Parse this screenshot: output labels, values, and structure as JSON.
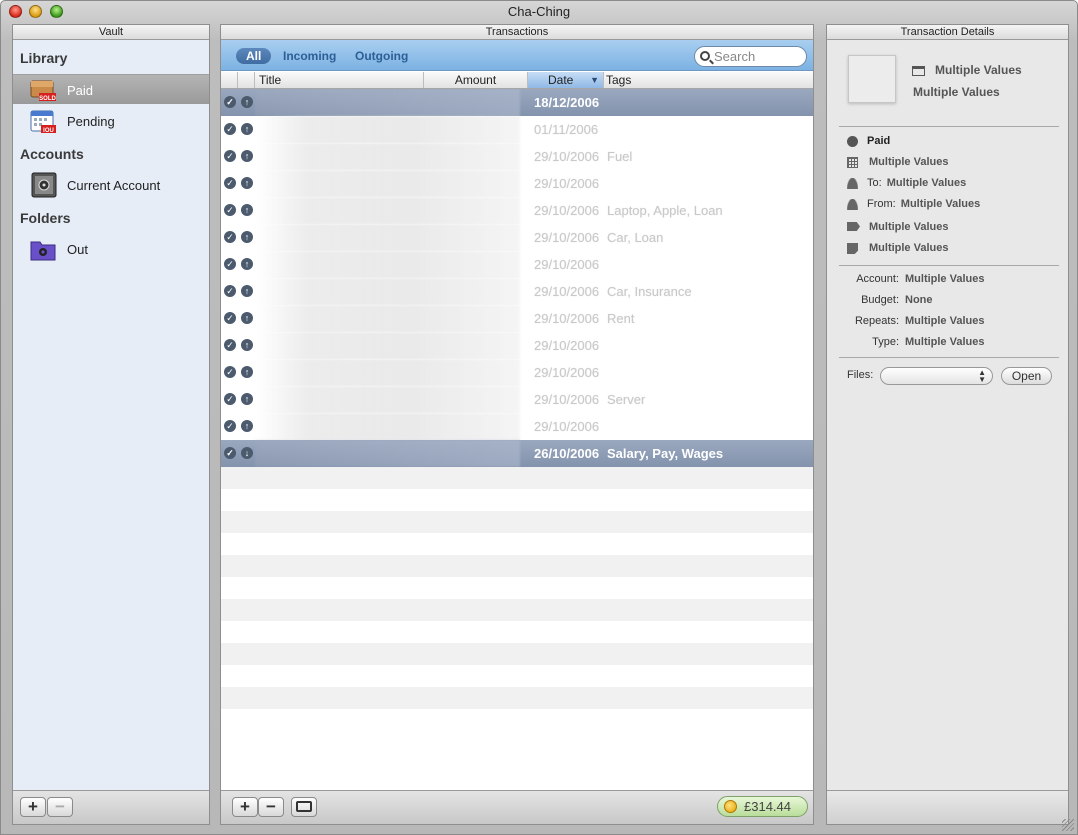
{
  "window": {
    "title": "Cha-Ching"
  },
  "vault": {
    "header": "Vault",
    "sections": {
      "library": "Library",
      "accounts": "Accounts",
      "folders": "Folders"
    },
    "items": {
      "paid": "Paid",
      "pending": "Pending",
      "current_account": "Current Account",
      "out": "Out"
    },
    "icon_badges": {
      "paid": "SOLD",
      "pending": "IOU"
    },
    "add_label": "+",
    "remove_label": "−"
  },
  "transactions": {
    "header": "Transactions",
    "filters": {
      "all": "All",
      "incoming": "Incoming",
      "outgoing": "Outgoing",
      "selected": "All"
    },
    "search": {
      "placeholder": "Search"
    },
    "columns": {
      "title": "Title",
      "amount": "Amount",
      "date": "Date",
      "tags": "Tags",
      "sort_indicator": "▼"
    },
    "rows": [
      {
        "date": "18/12/2006",
        "tags": "",
        "direction": "up",
        "highlighted": true
      },
      {
        "date": "01/11/2006",
        "tags": "",
        "direction": "up",
        "highlighted": false
      },
      {
        "date": "29/10/2006",
        "tags": "Fuel",
        "direction": "up",
        "highlighted": false
      },
      {
        "date": "29/10/2006",
        "tags": "",
        "direction": "up",
        "highlighted": false
      },
      {
        "date": "29/10/2006",
        "tags": "Laptop, Apple, Loan",
        "direction": "up",
        "highlighted": false
      },
      {
        "date": "29/10/2006",
        "tags": "Car, Loan",
        "direction": "up",
        "highlighted": false
      },
      {
        "date": "29/10/2006",
        "tags": "",
        "direction": "up",
        "highlighted": false
      },
      {
        "date": "29/10/2006",
        "tags": "Car, Insurance",
        "direction": "up",
        "highlighted": false
      },
      {
        "date": "29/10/2006",
        "tags": "Rent",
        "direction": "up",
        "highlighted": false
      },
      {
        "date": "29/10/2006",
        "tags": "",
        "direction": "up",
        "highlighted": false
      },
      {
        "date": "29/10/2006",
        "tags": "",
        "direction": "up",
        "highlighted": false
      },
      {
        "date": "29/10/2006",
        "tags": "Server",
        "direction": "up",
        "highlighted": false
      },
      {
        "date": "29/10/2006",
        "tags": "",
        "direction": "up",
        "highlighted": false
      },
      {
        "date": "26/10/2006",
        "tags": "Salary, Pay, Wages",
        "direction": "down",
        "highlighted": true
      }
    ],
    "total": "£314.44",
    "add_label": "+",
    "remove_label": "−"
  },
  "details": {
    "header": "Transaction Details",
    "title_line1": "Multiple Values",
    "title_line2": "Multiple Values",
    "status": "Paid",
    "category": "Multiple Values",
    "to_label": "To:",
    "to_value": "Multiple Values",
    "from_label": "From:",
    "from_value": "Multiple Values",
    "tag_value": "Multiple Values",
    "note_value": "Multiple Values",
    "account_label": "Account:",
    "account_value": "Multiple Values",
    "budget_label": "Budget:",
    "budget_value": "None",
    "repeats_label": "Repeats:",
    "repeats_value": "Multiple Values",
    "type_label": "Type:",
    "type_value": "Multiple Values",
    "files_label": "Files:",
    "open_label": "Open"
  }
}
